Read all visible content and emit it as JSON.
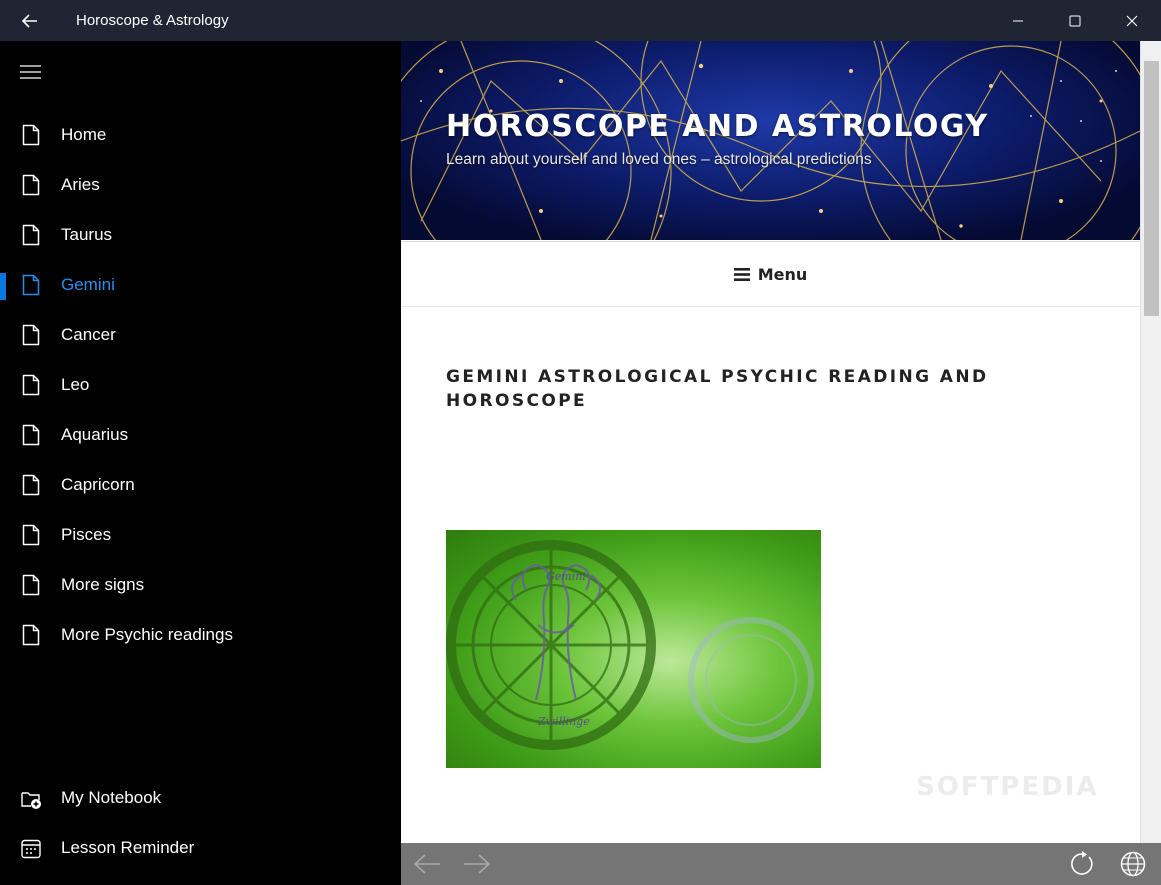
{
  "window": {
    "title": "Horoscope & Astrology",
    "back_icon": "back-arrow-icon",
    "controls": [
      "minimize-icon",
      "maximize-icon",
      "close-icon"
    ]
  },
  "sidebar": {
    "menu_icon": "hamburger-icon",
    "items": [
      {
        "label": "Home",
        "icon": "document-icon",
        "active": false
      },
      {
        "label": "Aries",
        "icon": "document-icon",
        "active": false
      },
      {
        "label": "Taurus",
        "icon": "document-icon",
        "active": false
      },
      {
        "label": "Gemini",
        "icon": "document-icon",
        "active": true
      },
      {
        "label": "Cancer",
        "icon": "document-icon",
        "active": false
      },
      {
        "label": "Leo",
        "icon": "document-icon",
        "active": false
      },
      {
        "label": "Aquarius",
        "icon": "document-icon",
        "active": false
      },
      {
        "label": "Capricorn",
        "icon": "document-icon",
        "active": false
      },
      {
        "label": "Pisces",
        "icon": "document-icon",
        "active": false
      },
      {
        "label": "More signs",
        "icon": "document-icon",
        "active": false
      },
      {
        "label": "More Psychic readings",
        "icon": "document-icon",
        "active": false
      }
    ],
    "footer": [
      {
        "label": "My Notebook",
        "icon": "notebook-add-icon"
      },
      {
        "label": "Lesson Reminder",
        "icon": "calendar-icon"
      }
    ],
    "accent_color": "#0a78e0"
  },
  "page": {
    "site_title": "HOROSCOPE AND ASTROLOGY",
    "site_subtitle": "Learn about yourself and loved ones – astrological predictions",
    "menu_label": "Menu",
    "post_title": "GEMINI ASTROLOGICAL PSYCHIC READING AND HOROSCOPE",
    "image_captions": {
      "top": "Gemini",
      "bottom": "Zwillinge"
    },
    "watermark": "SOFTPEDIA"
  },
  "toolbar": {
    "buttons": [
      "back-arrow-icon",
      "forward-arrow-icon",
      "refresh-icon",
      "globe-icon"
    ]
  }
}
